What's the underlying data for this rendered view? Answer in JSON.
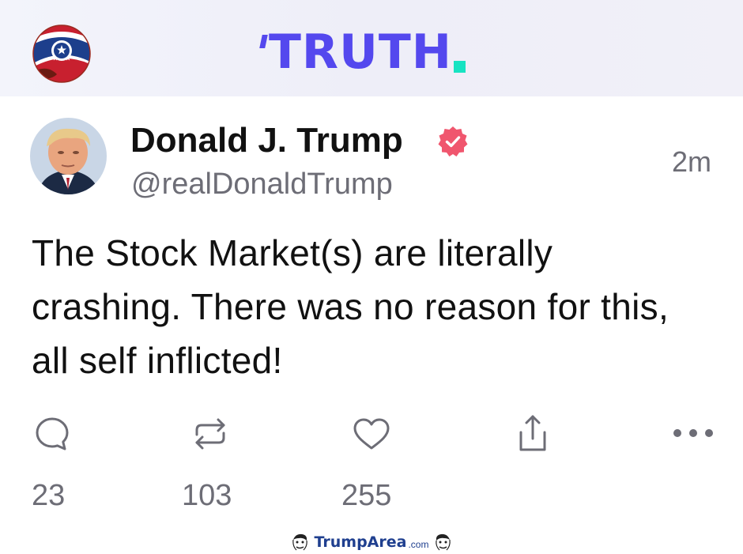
{
  "header": {
    "brand": "TRUTH",
    "brand_color": "#5448ee",
    "brand_dot_color": "#17e3c2"
  },
  "post": {
    "display_name": "Donald J. Trump",
    "verified": true,
    "verified_badge_color": "#f0566e",
    "handle": "@realDonaldTrump",
    "timestamp": "2m",
    "text": "The Stock Market(s) are literally crashing. There was no reason for this, all self inflicted!"
  },
  "actions": {
    "reply": {
      "icon": "reply-icon",
      "count": "23"
    },
    "retruth": {
      "icon": "retruth-icon",
      "count": "103"
    },
    "like": {
      "icon": "heart-icon",
      "count": "255"
    },
    "share": {
      "icon": "share-icon"
    },
    "more": {
      "icon": "more-icon"
    }
  },
  "watermark": {
    "text_main": "TrumpArea",
    "text_suffix": ".com"
  }
}
